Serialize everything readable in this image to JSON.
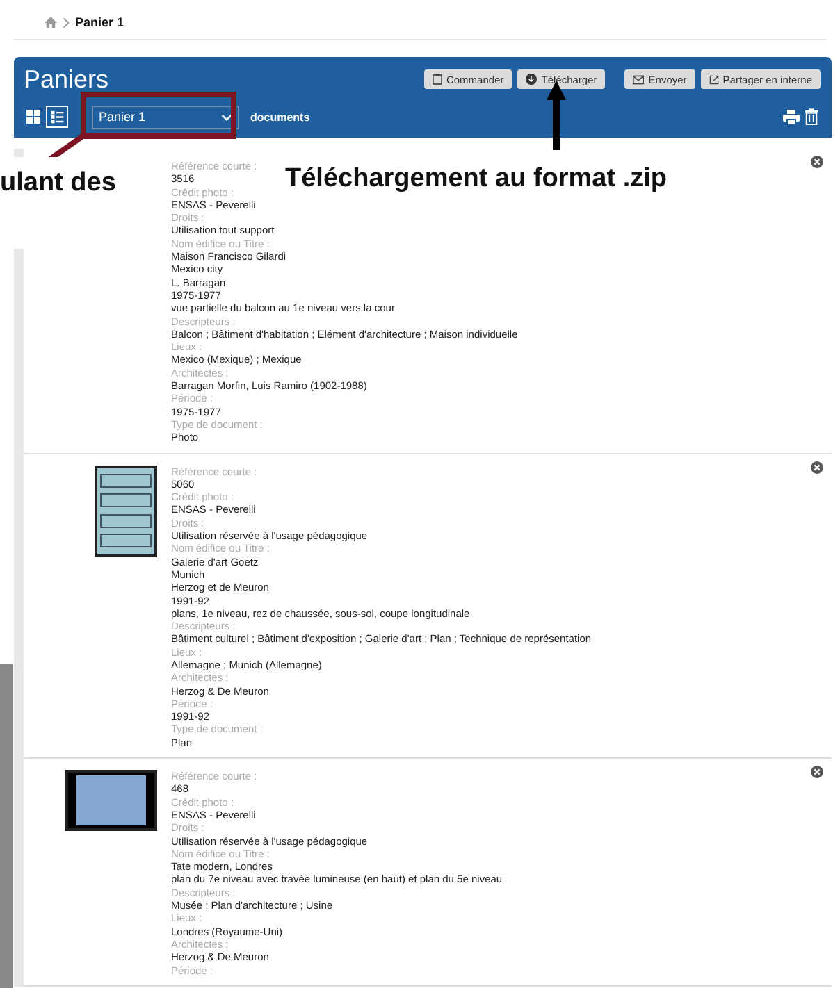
{
  "breadcrumb": {
    "current": "Panier 1"
  },
  "panel": {
    "title": "Paniers",
    "actions": [
      "Commander",
      "Télécharger",
      "Envoyer",
      "Partager en interne"
    ],
    "views": [
      {
        "kind": "grid",
        "selected": false
      },
      {
        "kind": "list",
        "selected": true
      }
    ],
    "basket_select": {
      "value": "Panier 1"
    },
    "count": "documents"
  },
  "records": [
    {
      "kind": "text",
      "fields": [
        {
          "label": "Référence courte :",
          "values": [
            "3516"
          ]
        },
        {
          "label": "Crédit photo :",
          "values": [
            "ENSAS - Peverelli"
          ]
        },
        {
          "label": "Droits :",
          "values": [
            "Utilisation tout support"
          ]
        },
        {
          "label": "Nom édifice ou Titre :",
          "values": [
            "Maison Francisco Gilardi",
            "Mexico city",
            "L. Barragan",
            "1975-1977",
            "vue partielle du balcon au 1e niveau vers la cour"
          ]
        },
        {
          "label": "Descripteurs :",
          "values": [
            "Balcon ; Bâtiment d'habitation ; Elément d'architecture ; Maison individuelle"
          ]
        },
        {
          "label": "Lieux :",
          "values": [
            "Mexico (Mexique) ; Mexique"
          ]
        },
        {
          "label": "Architectes :",
          "values": [
            "Barragan Morfin, Luis Ramiro (1902-1988)"
          ]
        },
        {
          "label": "Période :",
          "values": [
            "1975-1977"
          ]
        },
        {
          "label": "Type de document :",
          "values": [
            "Photo"
          ]
        }
      ]
    },
    {
      "kind": "plan",
      "fields": [
        {
          "label": "Référence courte :",
          "values": [
            "5060"
          ]
        },
        {
          "label": "Crédit photo :",
          "values": [
            "ENSAS - Peverelli"
          ]
        },
        {
          "label": "Droits :",
          "values": [
            "Utilisation réservée à l'usage pédagogique"
          ]
        },
        {
          "label": "Nom édifice ou Titre :",
          "values": [
            "Galerie d'art Goetz",
            "Munich",
            "Herzog et de Meuron",
            "1991-92",
            "plans, 1e niveau, rez de chaussée, sous-sol, coupe longitudinale"
          ]
        },
        {
          "label": "Descripteurs :",
          "values": [
            "Bâtiment culturel ; Bâtiment d'exposition ; Galerie d'art ; Plan ; Technique de représentation"
          ]
        },
        {
          "label": "Lieux :",
          "values": [
            "Allemagne ; Munich (Allemagne)"
          ]
        },
        {
          "label": "Architectes :",
          "values": [
            "Herzog & De Meuron"
          ]
        },
        {
          "label": "Période :",
          "values": [
            "1991-92"
          ]
        },
        {
          "label": "Type de document :",
          "values": [
            "Plan"
          ]
        }
      ]
    },
    {
      "kind": "slide",
      "fields": [
        {
          "label": "Référence courte :",
          "values": [
            "468"
          ]
        },
        {
          "label": "Crédit photo :",
          "values": [
            "ENSAS - Peverelli"
          ]
        },
        {
          "label": "Droits :",
          "values": [
            "Utilisation réservée à l'usage pédagogique"
          ]
        },
        {
          "label": "Nom édifice ou Titre :",
          "values": [
            "Tate modern, Londres",
            "plan du 7e niveau avec travée lumineuse (en haut) et plan du 5e niveau"
          ]
        },
        {
          "label": "Descripteurs :",
          "values": [
            "Musée ; Plan d'architecture ; Usine"
          ]
        },
        {
          "label": "Lieux :",
          "values": [
            "Londres (Royaume-Uni)"
          ]
        },
        {
          "label": "Architectes :",
          "values": [
            "Herzog & De Meuron"
          ]
        },
        {
          "label": "Période :"
        }
      ]
    }
  ],
  "annotations": [
    {
      "kind": "callout-left",
      "text": "ulant des"
    },
    {
      "kind": "callout-download",
      "text": "Téléchargement au format .zip"
    }
  ]
}
